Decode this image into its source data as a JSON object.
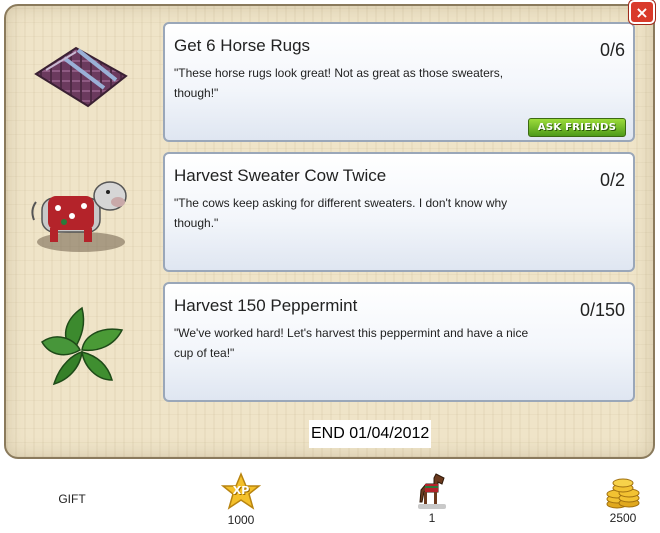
{
  "dialog": {
    "close_label": "×"
  },
  "quests": [
    {
      "title": "Get 6 Horse Rugs",
      "description": "\"These horse rugs look great! Not as great as those sweaters, though!\"",
      "progress": "0/6",
      "ask_button": "ASK FRIENDS",
      "icon": "horse-rug-icon"
    },
    {
      "title": "Harvest Sweater Cow Twice",
      "description": "\"The cows keep asking for different sweaters. I don't know why though.\"",
      "progress": "0/2",
      "icon": "sweater-cow-icon"
    },
    {
      "title": "Harvest 150 Peppermint",
      "description": "\"We've worked hard! Let's harvest this peppermint and have a nice cup of tea!\"",
      "progress": "0/150",
      "icon": "peppermint-icon"
    }
  ],
  "end_date": "END 01/04/2012",
  "rewards": {
    "gift_label": "GIFT",
    "xp": {
      "value": "1000",
      "icon": "xp-star-icon",
      "icon_text": "XP"
    },
    "horse": {
      "value": "1",
      "icon": "horse-icon"
    },
    "coins": {
      "value": "2500",
      "icon": "coins-icon"
    }
  },
  "colors": {
    "ask_button": "#5aa820",
    "close_button": "#d93a2a",
    "panel": "#efe4c8"
  }
}
